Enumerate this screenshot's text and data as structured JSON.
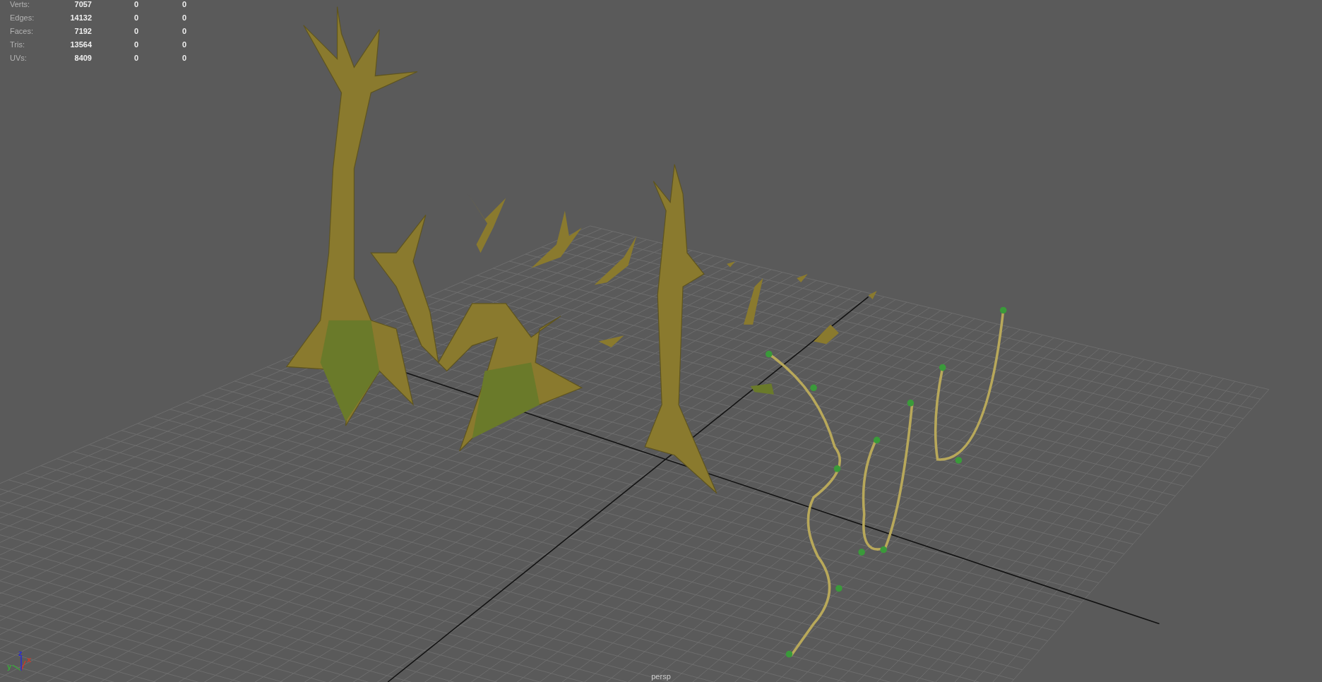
{
  "viewport": {
    "camera_label": "persp"
  },
  "hud": {
    "rows": [
      {
        "label": "Verts:",
        "value": "7057",
        "column_2": "0",
        "column_3": "0"
      },
      {
        "label": "Edges:",
        "value": "14132",
        "column_2": "0",
        "column_3": "0"
      },
      {
        "label": "Faces:",
        "value": "7192",
        "column_2": "0",
        "column_3": "0"
      },
      {
        "label": "Tris:",
        "value": "13564",
        "column_2": "0",
        "column_3": "0"
      },
      {
        "label": "UVs:",
        "value": "8409",
        "column_2": "0",
        "column_3": "0"
      }
    ]
  },
  "axis_gizmo": {
    "axes": [
      {
        "label": "x",
        "color": "#c83a2a"
      },
      {
        "label": "y",
        "color": "#3aa83a"
      },
      {
        "label": "z",
        "color": "#2a2ad0"
      }
    ]
  }
}
